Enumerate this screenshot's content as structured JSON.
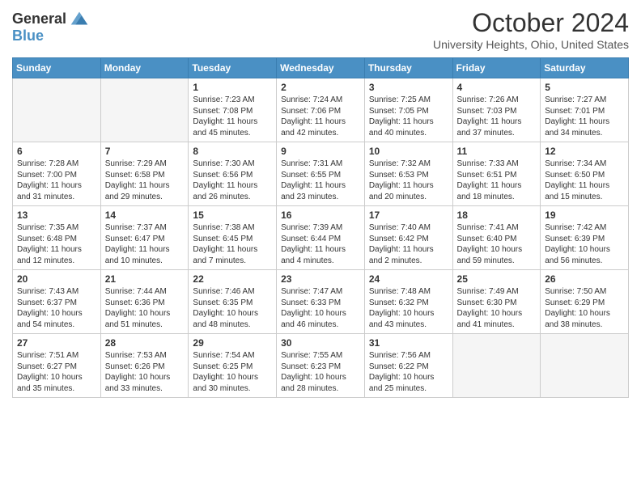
{
  "header": {
    "logo_line1": "General",
    "logo_line2": "Blue",
    "month": "October 2024",
    "location": "University Heights, Ohio, United States"
  },
  "days_of_week": [
    "Sunday",
    "Monday",
    "Tuesday",
    "Wednesday",
    "Thursday",
    "Friday",
    "Saturday"
  ],
  "weeks": [
    [
      {
        "day": "",
        "empty": true
      },
      {
        "day": "",
        "empty": true
      },
      {
        "day": "1",
        "sunrise": "Sunrise: 7:23 AM",
        "sunset": "Sunset: 7:08 PM",
        "daylight": "Daylight: 11 hours and 45 minutes."
      },
      {
        "day": "2",
        "sunrise": "Sunrise: 7:24 AM",
        "sunset": "Sunset: 7:06 PM",
        "daylight": "Daylight: 11 hours and 42 minutes."
      },
      {
        "day": "3",
        "sunrise": "Sunrise: 7:25 AM",
        "sunset": "Sunset: 7:05 PM",
        "daylight": "Daylight: 11 hours and 40 minutes."
      },
      {
        "day": "4",
        "sunrise": "Sunrise: 7:26 AM",
        "sunset": "Sunset: 7:03 PM",
        "daylight": "Daylight: 11 hours and 37 minutes."
      },
      {
        "day": "5",
        "sunrise": "Sunrise: 7:27 AM",
        "sunset": "Sunset: 7:01 PM",
        "daylight": "Daylight: 11 hours and 34 minutes."
      }
    ],
    [
      {
        "day": "6",
        "sunrise": "Sunrise: 7:28 AM",
        "sunset": "Sunset: 7:00 PM",
        "daylight": "Daylight: 11 hours and 31 minutes."
      },
      {
        "day": "7",
        "sunrise": "Sunrise: 7:29 AM",
        "sunset": "Sunset: 6:58 PM",
        "daylight": "Daylight: 11 hours and 29 minutes."
      },
      {
        "day": "8",
        "sunrise": "Sunrise: 7:30 AM",
        "sunset": "Sunset: 6:56 PM",
        "daylight": "Daylight: 11 hours and 26 minutes."
      },
      {
        "day": "9",
        "sunrise": "Sunrise: 7:31 AM",
        "sunset": "Sunset: 6:55 PM",
        "daylight": "Daylight: 11 hours and 23 minutes."
      },
      {
        "day": "10",
        "sunrise": "Sunrise: 7:32 AM",
        "sunset": "Sunset: 6:53 PM",
        "daylight": "Daylight: 11 hours and 20 minutes."
      },
      {
        "day": "11",
        "sunrise": "Sunrise: 7:33 AM",
        "sunset": "Sunset: 6:51 PM",
        "daylight": "Daylight: 11 hours and 18 minutes."
      },
      {
        "day": "12",
        "sunrise": "Sunrise: 7:34 AM",
        "sunset": "Sunset: 6:50 PM",
        "daylight": "Daylight: 11 hours and 15 minutes."
      }
    ],
    [
      {
        "day": "13",
        "sunrise": "Sunrise: 7:35 AM",
        "sunset": "Sunset: 6:48 PM",
        "daylight": "Daylight: 11 hours and 12 minutes."
      },
      {
        "day": "14",
        "sunrise": "Sunrise: 7:37 AM",
        "sunset": "Sunset: 6:47 PM",
        "daylight": "Daylight: 11 hours and 10 minutes."
      },
      {
        "day": "15",
        "sunrise": "Sunrise: 7:38 AM",
        "sunset": "Sunset: 6:45 PM",
        "daylight": "Daylight: 11 hours and 7 minutes."
      },
      {
        "day": "16",
        "sunrise": "Sunrise: 7:39 AM",
        "sunset": "Sunset: 6:44 PM",
        "daylight": "Daylight: 11 hours and 4 minutes."
      },
      {
        "day": "17",
        "sunrise": "Sunrise: 7:40 AM",
        "sunset": "Sunset: 6:42 PM",
        "daylight": "Daylight: 11 hours and 2 minutes."
      },
      {
        "day": "18",
        "sunrise": "Sunrise: 7:41 AM",
        "sunset": "Sunset: 6:40 PM",
        "daylight": "Daylight: 10 hours and 59 minutes."
      },
      {
        "day": "19",
        "sunrise": "Sunrise: 7:42 AM",
        "sunset": "Sunset: 6:39 PM",
        "daylight": "Daylight: 10 hours and 56 minutes."
      }
    ],
    [
      {
        "day": "20",
        "sunrise": "Sunrise: 7:43 AM",
        "sunset": "Sunset: 6:37 PM",
        "daylight": "Daylight: 10 hours and 54 minutes."
      },
      {
        "day": "21",
        "sunrise": "Sunrise: 7:44 AM",
        "sunset": "Sunset: 6:36 PM",
        "daylight": "Daylight: 10 hours and 51 minutes."
      },
      {
        "day": "22",
        "sunrise": "Sunrise: 7:46 AM",
        "sunset": "Sunset: 6:35 PM",
        "daylight": "Daylight: 10 hours and 48 minutes."
      },
      {
        "day": "23",
        "sunrise": "Sunrise: 7:47 AM",
        "sunset": "Sunset: 6:33 PM",
        "daylight": "Daylight: 10 hours and 46 minutes."
      },
      {
        "day": "24",
        "sunrise": "Sunrise: 7:48 AM",
        "sunset": "Sunset: 6:32 PM",
        "daylight": "Daylight: 10 hours and 43 minutes."
      },
      {
        "day": "25",
        "sunrise": "Sunrise: 7:49 AM",
        "sunset": "Sunset: 6:30 PM",
        "daylight": "Daylight: 10 hours and 41 minutes."
      },
      {
        "day": "26",
        "sunrise": "Sunrise: 7:50 AM",
        "sunset": "Sunset: 6:29 PM",
        "daylight": "Daylight: 10 hours and 38 minutes."
      }
    ],
    [
      {
        "day": "27",
        "sunrise": "Sunrise: 7:51 AM",
        "sunset": "Sunset: 6:27 PM",
        "daylight": "Daylight: 10 hours and 35 minutes."
      },
      {
        "day": "28",
        "sunrise": "Sunrise: 7:53 AM",
        "sunset": "Sunset: 6:26 PM",
        "daylight": "Daylight: 10 hours and 33 minutes."
      },
      {
        "day": "29",
        "sunrise": "Sunrise: 7:54 AM",
        "sunset": "Sunset: 6:25 PM",
        "daylight": "Daylight: 10 hours and 30 minutes."
      },
      {
        "day": "30",
        "sunrise": "Sunrise: 7:55 AM",
        "sunset": "Sunset: 6:23 PM",
        "daylight": "Daylight: 10 hours and 28 minutes."
      },
      {
        "day": "31",
        "sunrise": "Sunrise: 7:56 AM",
        "sunset": "Sunset: 6:22 PM",
        "daylight": "Daylight: 10 hours and 25 minutes."
      },
      {
        "day": "",
        "empty": true
      },
      {
        "day": "",
        "empty": true
      }
    ]
  ]
}
